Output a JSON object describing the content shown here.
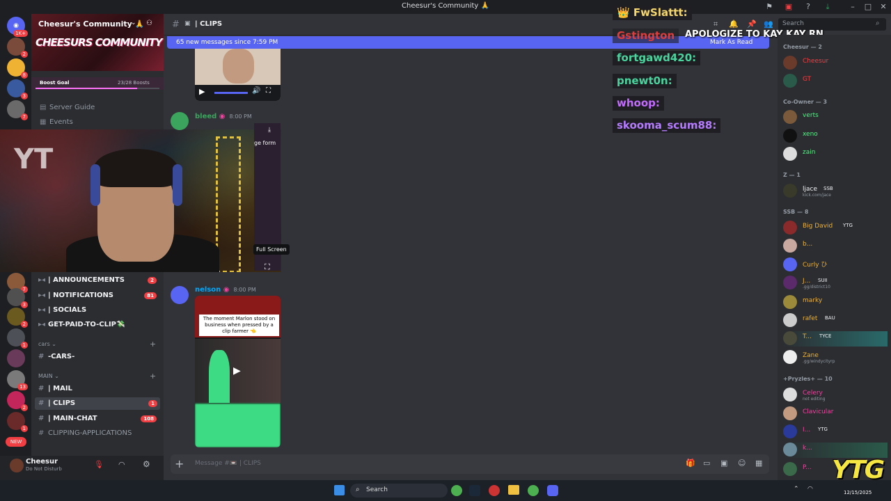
{
  "window": {
    "title": "Cheesur's Community 🙏"
  },
  "server": {
    "name": "Cheesur's Community 🙏",
    "banner_text": "CHEESURS COMMUNITY",
    "boost_goal_label": "Boost Goal",
    "boost_progress": "23/28 Boosts",
    "boost_fraction": 0.82
  },
  "rail_badges": [
    "1K+",
    "2",
    "8",
    "3",
    "7",
    "7",
    "3",
    "2",
    "1",
    "13",
    "2",
    "1"
  ],
  "rail_new": "NEW",
  "sidebar_top": [
    {
      "label": "Server Guide"
    },
    {
      "label": "Events"
    }
  ],
  "channels": [
    {
      "label": "| ANNOUNCEMENTS",
      "badge": "2"
    },
    {
      "label": "| NOTIFICATIONS",
      "badge": "81"
    },
    {
      "label": "| SOCIALS",
      "badge": ""
    },
    {
      "label": "GET-PAID-TO-CLIP💸",
      "badge": ""
    }
  ],
  "categories": {
    "cars": "cars",
    "main": "MAIN"
  },
  "cars_channel": "-CARS-",
  "main_channels": [
    {
      "label": "| MAIL",
      "badge": ""
    },
    {
      "label": "| CLIPS",
      "badge": "1"
    },
    {
      "label": "| MAIN-CHAT",
      "badge": "108"
    },
    {
      "label": "CLIPPING-APPLICATIONS",
      "badge": ""
    }
  ],
  "user": {
    "name": "Cheesur",
    "status": "Do Not Disturb"
  },
  "chat": {
    "channel": "| CLIPS",
    "new_messages": "65 new messages since 7:59 PM",
    "mark_as_read": "Mark As Read",
    "tooltip": "Full Screen",
    "video_overlay_text": "ge form",
    "messages": [
      {
        "author": "bleed",
        "time": "8:00 PM",
        "color": "#3ba55d"
      },
      {
        "author": "nelson",
        "time": "8:00 PM",
        "color": "#00a8fc"
      }
    ],
    "clip_caption": "The moment Marlon stood on business when pressed by a clip farmer 👈",
    "composer_placeholder": "Message #📼 | CLIPS"
  },
  "search": {
    "placeholder": "Search"
  },
  "stream_overlay": {
    "chat": [
      {
        "name": "FwSlattt:",
        "color": "#f5d76e"
      },
      {
        "name": "Gstington",
        "color": "#e03c3c"
      },
      {
        "name": "fortgawd420:",
        "color": "#49d49d"
      },
      {
        "name": "pnewt0n:",
        "color": "#49d49d"
      },
      {
        "name": "whoop:",
        "color": "#c46bff"
      },
      {
        "name": "skooma_scum88:",
        "color": "#b57bff"
      }
    ],
    "banner": "APOLOGIZE TO KAY KAY RN",
    "watermark": "YTG"
  },
  "members": {
    "groups": [
      {
        "header": "Cheesur — 2",
        "items": [
          {
            "name": "Cheesur",
            "sub": "",
            "color": "#f23f43"
          },
          {
            "name": "GT",
            "sub": "",
            "color": "#f23f43"
          }
        ]
      },
      {
        "header": "Co-Owner — 3",
        "items": [
          {
            "name": "verts",
            "sub": "",
            "color": "#57f287"
          },
          {
            "name": "xeno",
            "sub": "",
            "color": "#57f287"
          },
          {
            "name": "zain",
            "sub": "",
            "color": "#57f287"
          }
        ]
      },
      {
        "header": "Z — 1",
        "items": [
          {
            "name": "ljace",
            "sub": "kick.com/jace",
            "color": "#f2f3f5"
          }
        ]
      },
      {
        "header": "SSB — 8",
        "items": [
          {
            "name": "Big David",
            "sub": "",
            "color": "#f0b232"
          },
          {
            "name": "b...",
            "sub": "",
            "color": "#f0b232"
          },
          {
            "name": "Curly ひ",
            "sub": "",
            "color": "#f0b232"
          },
          {
            "name": "J...",
            "sub": ".gg/district10",
            "color": "#f0b232"
          },
          {
            "name": "marky",
            "sub": "",
            "color": "#f0b232"
          },
          {
            "name": "rafet",
            "sub": "",
            "color": "#f0b232"
          },
          {
            "name": "T...",
            "sub": "",
            "color": "#f0b232"
          },
          {
            "name": "Zane",
            "sub": ".gg/windycityrp",
            "color": "#f0b232"
          }
        ]
      },
      {
        "header": "+Pryzles+ — 10",
        "items": [
          {
            "name": "Celery",
            "sub": "not editing",
            "color": "#eb459e"
          },
          {
            "name": "Clavicular",
            "sub": "",
            "color": "#eb459e"
          },
          {
            "name": "I...",
            "sub": "",
            "color": "#eb459e"
          },
          {
            "name": "k...",
            "sub": "",
            "color": "#eb459e"
          },
          {
            "name": "P...",
            "sub": "",
            "color": "#eb459e"
          }
        ]
      }
    ]
  },
  "member_tags": {
    "ljace": "SSB",
    "bigdavid": "YTG",
    "j": "SUII",
    "rafet": "BAU",
    "t": "TYCE",
    "i": "YTG"
  },
  "taskbar": {
    "search": "Search",
    "date": "12/15/2025"
  }
}
